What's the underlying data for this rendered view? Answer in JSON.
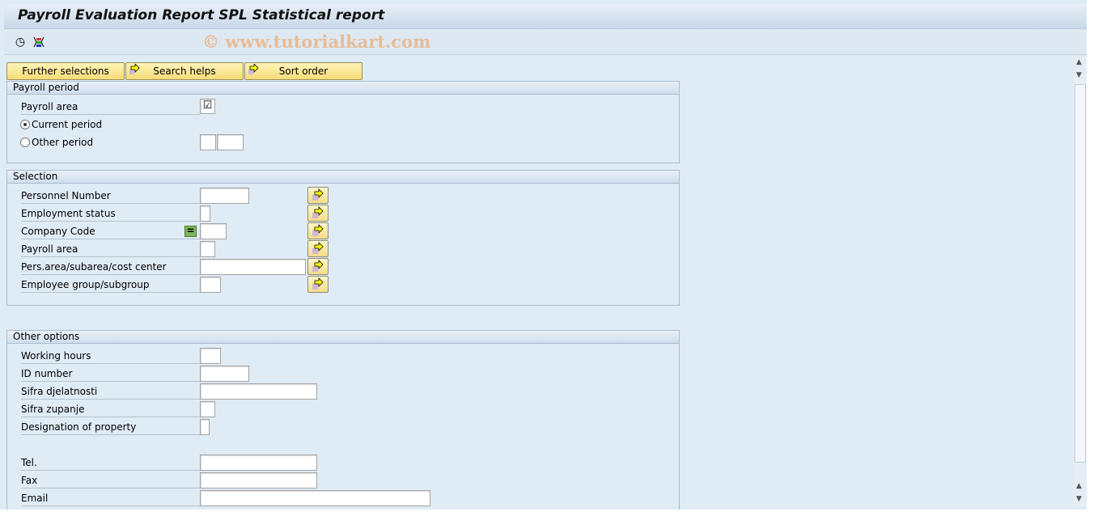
{
  "window": {
    "title": "Payroll Evaluation Report SPL Statistical report",
    "watermark": "© www.tutorialkart.com"
  },
  "toolbar": {
    "icons": [
      "execute-clock-icon",
      "selection-variant-icon"
    ]
  },
  "top_buttons": [
    {
      "label": "Further selections",
      "arrow": false
    },
    {
      "label": "Search helps",
      "arrow": true
    },
    {
      "label": "Sort order",
      "arrow": true
    }
  ],
  "payroll_period": {
    "title": "Payroll period",
    "payroll_area_label": "Payroll area",
    "payroll_area_checked": true,
    "current_period_label": "Current period",
    "other_period_label": "Other period",
    "selected_radio": "current",
    "other_period_values": [
      "",
      ""
    ]
  },
  "selection": {
    "title": "Selection",
    "fields": [
      {
        "label": "Personnel Number",
        "value": ""
      },
      {
        "label": "Employment status",
        "value": ""
      },
      {
        "label": "Company Code",
        "value": "",
        "option_icon": "equals-icon"
      },
      {
        "label": "Payroll area",
        "value": ""
      },
      {
        "label": "Pers.area/subarea/cost center",
        "value": ""
      },
      {
        "label": "Employee group/subgroup",
        "value": ""
      }
    ]
  },
  "other_options": {
    "title": "Other options",
    "fields": [
      {
        "label": "Working hours",
        "value": ""
      },
      {
        "label": "ID number",
        "value": ""
      },
      {
        "label": "Sifra djelatnosti",
        "value": ""
      },
      {
        "label": "Sifra zupanje",
        "value": ""
      },
      {
        "label": "Designation of property",
        "value": ""
      },
      {
        "label": "Tel.",
        "value": ""
      },
      {
        "label": "Fax",
        "value": ""
      },
      {
        "label": "Email",
        "value": ""
      }
    ]
  },
  "colors": {
    "background": "#dfebf5",
    "button": "#f6dc78",
    "watermark": "#e9b98d"
  }
}
